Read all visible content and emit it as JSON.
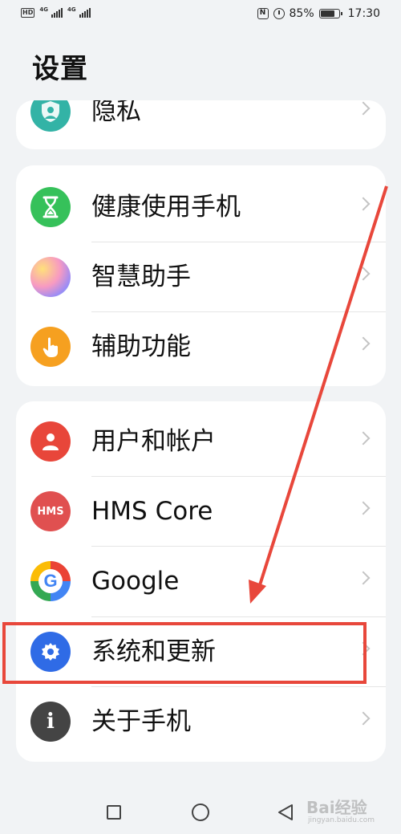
{
  "status_bar": {
    "hd": "HD",
    "net1": "4G",
    "net2": "4G",
    "battery": "85%",
    "battery_level": 0.85,
    "time": "17:30",
    "icons": [
      "hd-icon",
      "signal-icon",
      "signal-icon",
      "nfc-icon",
      "alarm-icon",
      "battery-icon"
    ]
  },
  "page_title": "设置",
  "groups": [
    {
      "items": [
        {
          "label": "隐私",
          "icon": "privacy-icon",
          "color": "#33b3a6"
        }
      ]
    },
    {
      "items": [
        {
          "label": "健康使用手机",
          "icon": "hourglass-icon",
          "color": "#36c15a"
        },
        {
          "label": "智慧助手",
          "icon": "assistant-orb-icon",
          "color": "#f08ac8"
        },
        {
          "label": "辅助功能",
          "icon": "hand-icon",
          "color": "#f6a020"
        }
      ]
    },
    {
      "items": [
        {
          "label": "用户和帐户",
          "icon": "user-icon",
          "color": "#e8463a"
        },
        {
          "label": "HMS Core",
          "icon": "hms-icon",
          "color": "#e05050",
          "icon_text": "HMS"
        },
        {
          "label": "Google",
          "icon": "google-icon",
          "color": "#4285f4"
        },
        {
          "label": "系统和更新",
          "icon": "gear-icon",
          "color": "#2f6be6"
        },
        {
          "label": "关于手机",
          "icon": "info-icon",
          "color": "#444444"
        }
      ]
    }
  ],
  "annotation": {
    "color": "#e8473b",
    "highlighted": "系统和更新"
  },
  "watermark": {
    "text": "Bai经验",
    "sub": "jingyan.baidu.com"
  }
}
